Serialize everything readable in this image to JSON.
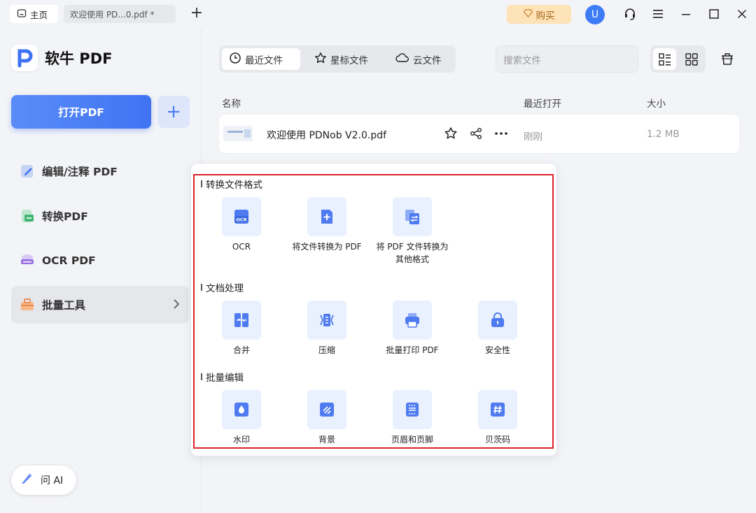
{
  "titlebar": {
    "home_tab": "主页",
    "doc_tab": "欢迎使用 PD...0.pdf *",
    "buy_label": "购买",
    "avatar_letter": "U"
  },
  "sidebar": {
    "app_name": "软牛 PDF",
    "open_button": "打开PDF",
    "items": [
      {
        "label": "编辑/注释 PDF"
      },
      {
        "label": "转换PDF"
      },
      {
        "label": "OCR PDF"
      },
      {
        "label": "批量工具"
      }
    ],
    "ai_button": "问 AI"
  },
  "main": {
    "tabs": [
      {
        "label": "最近文件"
      },
      {
        "label": "星标文件"
      },
      {
        "label": "云文件"
      }
    ],
    "search_placeholder": "搜索文件",
    "columns": {
      "name": "名称",
      "recent": "最近打开",
      "size": "大小"
    },
    "files": [
      {
        "name": "欢迎使用 PDNob V2.0.pdf",
        "opened": "刚刚",
        "size": "1.2 MB"
      }
    ]
  },
  "popup": {
    "sections": [
      {
        "title": "转换文件格式",
        "tools": [
          {
            "label": "OCR"
          },
          {
            "label": "将文件转换为 PDF"
          },
          {
            "label": "将 PDF 文件转换为\n其他格式"
          }
        ]
      },
      {
        "title": "文档处理",
        "tools": [
          {
            "label": "合并"
          },
          {
            "label": "压缩"
          },
          {
            "label": "批量打印 PDF"
          },
          {
            "label": "安全性"
          }
        ]
      },
      {
        "title": "批量编辑",
        "tools": [
          {
            "label": "水印"
          },
          {
            "label": "背景"
          },
          {
            "label": "页眉和页脚"
          },
          {
            "label": "贝茨码"
          }
        ]
      }
    ]
  },
  "colors": {
    "accent": "#3f73f2",
    "highlight": "#d9232a",
    "buy_bg": "#fde3b7"
  }
}
